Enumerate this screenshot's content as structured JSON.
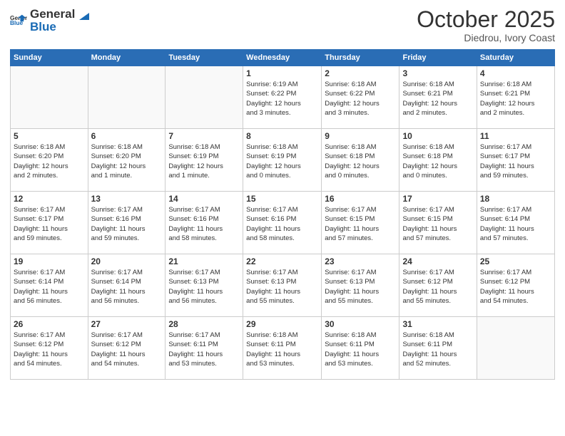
{
  "header": {
    "logo": {
      "general": "General",
      "blue": "Blue"
    },
    "month": "October 2025",
    "location": "Diedrou, Ivory Coast"
  },
  "days_of_week": [
    "Sunday",
    "Monday",
    "Tuesday",
    "Wednesday",
    "Thursday",
    "Friday",
    "Saturday"
  ],
  "weeks": [
    [
      {
        "day": "",
        "info": ""
      },
      {
        "day": "",
        "info": ""
      },
      {
        "day": "",
        "info": ""
      },
      {
        "day": "1",
        "info": "Sunrise: 6:19 AM\nSunset: 6:22 PM\nDaylight: 12 hours\nand 3 minutes."
      },
      {
        "day": "2",
        "info": "Sunrise: 6:18 AM\nSunset: 6:22 PM\nDaylight: 12 hours\nand 3 minutes."
      },
      {
        "day": "3",
        "info": "Sunrise: 6:18 AM\nSunset: 6:21 PM\nDaylight: 12 hours\nand 2 minutes."
      },
      {
        "day": "4",
        "info": "Sunrise: 6:18 AM\nSunset: 6:21 PM\nDaylight: 12 hours\nand 2 minutes."
      }
    ],
    [
      {
        "day": "5",
        "info": "Sunrise: 6:18 AM\nSunset: 6:20 PM\nDaylight: 12 hours\nand 2 minutes."
      },
      {
        "day": "6",
        "info": "Sunrise: 6:18 AM\nSunset: 6:20 PM\nDaylight: 12 hours\nand 1 minute."
      },
      {
        "day": "7",
        "info": "Sunrise: 6:18 AM\nSunset: 6:19 PM\nDaylight: 12 hours\nand 1 minute."
      },
      {
        "day": "8",
        "info": "Sunrise: 6:18 AM\nSunset: 6:19 PM\nDaylight: 12 hours\nand 0 minutes."
      },
      {
        "day": "9",
        "info": "Sunrise: 6:18 AM\nSunset: 6:18 PM\nDaylight: 12 hours\nand 0 minutes."
      },
      {
        "day": "10",
        "info": "Sunrise: 6:18 AM\nSunset: 6:18 PM\nDaylight: 12 hours\nand 0 minutes."
      },
      {
        "day": "11",
        "info": "Sunrise: 6:17 AM\nSunset: 6:17 PM\nDaylight: 11 hours\nand 59 minutes."
      }
    ],
    [
      {
        "day": "12",
        "info": "Sunrise: 6:17 AM\nSunset: 6:17 PM\nDaylight: 11 hours\nand 59 minutes."
      },
      {
        "day": "13",
        "info": "Sunrise: 6:17 AM\nSunset: 6:16 PM\nDaylight: 11 hours\nand 59 minutes."
      },
      {
        "day": "14",
        "info": "Sunrise: 6:17 AM\nSunset: 6:16 PM\nDaylight: 11 hours\nand 58 minutes."
      },
      {
        "day": "15",
        "info": "Sunrise: 6:17 AM\nSunset: 6:16 PM\nDaylight: 11 hours\nand 58 minutes."
      },
      {
        "day": "16",
        "info": "Sunrise: 6:17 AM\nSunset: 6:15 PM\nDaylight: 11 hours\nand 57 minutes."
      },
      {
        "day": "17",
        "info": "Sunrise: 6:17 AM\nSunset: 6:15 PM\nDaylight: 11 hours\nand 57 minutes."
      },
      {
        "day": "18",
        "info": "Sunrise: 6:17 AM\nSunset: 6:14 PM\nDaylight: 11 hours\nand 57 minutes."
      }
    ],
    [
      {
        "day": "19",
        "info": "Sunrise: 6:17 AM\nSunset: 6:14 PM\nDaylight: 11 hours\nand 56 minutes."
      },
      {
        "day": "20",
        "info": "Sunrise: 6:17 AM\nSunset: 6:14 PM\nDaylight: 11 hours\nand 56 minutes."
      },
      {
        "day": "21",
        "info": "Sunrise: 6:17 AM\nSunset: 6:13 PM\nDaylight: 11 hours\nand 56 minutes."
      },
      {
        "day": "22",
        "info": "Sunrise: 6:17 AM\nSunset: 6:13 PM\nDaylight: 11 hours\nand 55 minutes."
      },
      {
        "day": "23",
        "info": "Sunrise: 6:17 AM\nSunset: 6:13 PM\nDaylight: 11 hours\nand 55 minutes."
      },
      {
        "day": "24",
        "info": "Sunrise: 6:17 AM\nSunset: 6:12 PM\nDaylight: 11 hours\nand 55 minutes."
      },
      {
        "day": "25",
        "info": "Sunrise: 6:17 AM\nSunset: 6:12 PM\nDaylight: 11 hours\nand 54 minutes."
      }
    ],
    [
      {
        "day": "26",
        "info": "Sunrise: 6:17 AM\nSunset: 6:12 PM\nDaylight: 11 hours\nand 54 minutes."
      },
      {
        "day": "27",
        "info": "Sunrise: 6:17 AM\nSunset: 6:12 PM\nDaylight: 11 hours\nand 54 minutes."
      },
      {
        "day": "28",
        "info": "Sunrise: 6:17 AM\nSunset: 6:11 PM\nDaylight: 11 hours\nand 53 minutes."
      },
      {
        "day": "29",
        "info": "Sunrise: 6:18 AM\nSunset: 6:11 PM\nDaylight: 11 hours\nand 53 minutes."
      },
      {
        "day": "30",
        "info": "Sunrise: 6:18 AM\nSunset: 6:11 PM\nDaylight: 11 hours\nand 53 minutes."
      },
      {
        "day": "31",
        "info": "Sunrise: 6:18 AM\nSunset: 6:11 PM\nDaylight: 11 hours\nand 52 minutes."
      },
      {
        "day": "",
        "info": ""
      }
    ]
  ]
}
